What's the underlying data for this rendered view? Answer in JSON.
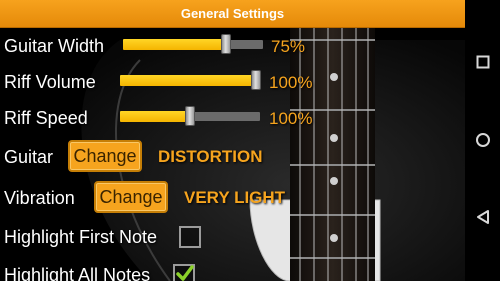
{
  "title": "General Settings",
  "settings": {
    "guitar_width": {
      "label": "Guitar Width",
      "value_text": "75%",
      "level": 0.75
    },
    "riff_volume": {
      "label": "Riff Volume",
      "value_text": "100%",
      "level": 1.0
    },
    "riff_speed": {
      "label": "Riff Speed",
      "value_text": "100%",
      "level": 0.5
    },
    "guitar": {
      "label": "Guitar",
      "button": "Change",
      "value": "DISTORTION"
    },
    "vibration": {
      "label": "Vibration",
      "button": "Change",
      "value": "VERY LIGHT"
    },
    "highlight_first_note": {
      "label": "Highlight First Note",
      "checked": false
    },
    "highlight_all_notes": {
      "label": "Highlight All Notes",
      "checked": true
    }
  },
  "colors": {
    "accent": "#f6a41e",
    "title_bar": "#ee9311",
    "slider_fill": "#ffd626",
    "checkmark": "#8bd12a"
  },
  "nav": {
    "buttons": [
      "square-icon",
      "circle-icon",
      "triangle-icon"
    ]
  }
}
